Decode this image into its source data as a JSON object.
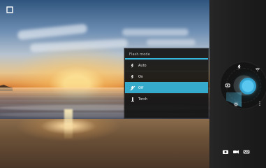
{
  "screen": {
    "viewfinder": {
      "scene_name": "sunset-beach-scene"
    }
  },
  "top_left_button": {
    "icon": "square-icon"
  },
  "settings_menu": {
    "title": "Flash mode",
    "items": [
      {
        "label": "Auto",
        "icon": "auto-flash-icon"
      },
      {
        "label": "On",
        "icon": "flash-on-icon"
      },
      {
        "label": "Off",
        "icon": "flash-off-icon"
      },
      {
        "label": "Torch",
        "icon": "torch-icon"
      }
    ],
    "selected_index": 2
  },
  "control_panel": {
    "icons": {
      "top": "flash-icon",
      "left": "camera-switch-icon",
      "right": "wifi-icon",
      "bottom_left": "settings-icon",
      "bottom_right": "more-icon"
    },
    "mode_switcher": [
      "camera-icon",
      "video-icon",
      "pano-icon"
    ]
  },
  "colors": {
    "accent": "#35b6df",
    "accent_dark": "#2a86b1",
    "menu_background": "#121212",
    "panel_background": "#1f1f1f"
  }
}
